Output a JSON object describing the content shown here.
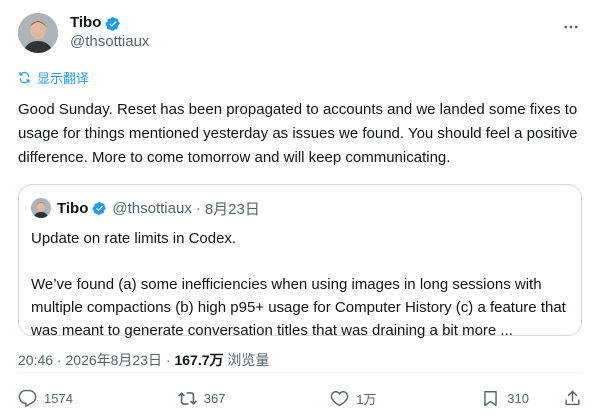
{
  "author": {
    "name": "Tibo",
    "handle": "@thsottiaux",
    "verified": true
  },
  "translate_label": "显示翻译",
  "tweet_text": "Good Sunday. Reset has been propagated to accounts and we landed some fixes to usage for things mentioned yesterday as issues we found. You should feel a positive difference. More to come tomorrow and will keep communicating.",
  "quote": {
    "name": "Tibo",
    "handle": "@thsottiaux",
    "separator": "·",
    "date": "8月23日",
    "line1": "Update on rate limits in Codex.",
    "line2": "We’ve found (a) some inefficiencies when using images in long sessions with multiple compactions (b) high p95+ usage for Computer History (c) a feature that was meant to generate conversation titles that was draining a bit more ..."
  },
  "meta": {
    "time": "20:46",
    "separator": " · ",
    "date": "2026年8月23日",
    "views_count": "167.7万",
    "views_label": " 浏览量"
  },
  "actions": {
    "replies": "1574",
    "reposts": "367",
    "likes": "1万",
    "bookmarks": "310"
  },
  "colors": {
    "accent": "#1d9bf0",
    "secondary_text": "#536471",
    "border": "#cfd9de"
  },
  "icons": [
    "verified-badge-icon",
    "more-icon",
    "translate-icon",
    "reply-icon",
    "repost-icon",
    "like-icon",
    "bookmark-icon",
    "share-icon"
  ]
}
